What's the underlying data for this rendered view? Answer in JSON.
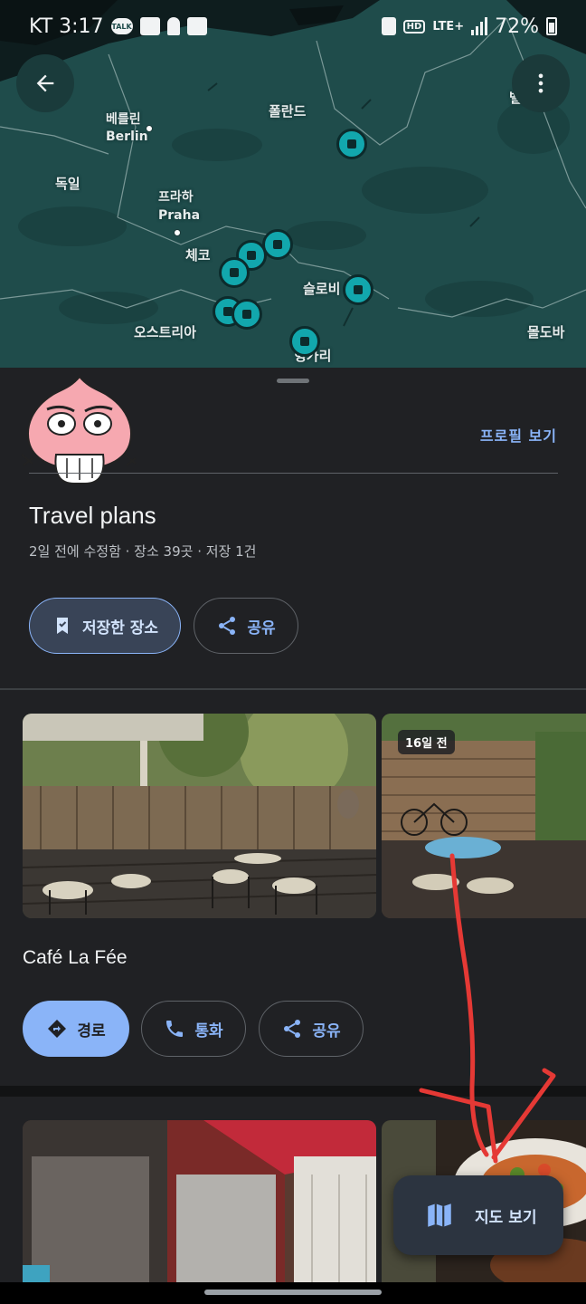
{
  "status_bar": {
    "carrier_time": "KT 3:17",
    "talk_badge": "TALK",
    "hd": "HD",
    "network": "LTE+",
    "battery": "72%"
  },
  "map": {
    "labels": {
      "berlin_ko": "베를린",
      "berlin_en": "Berlin",
      "germany": "독일",
      "poland": "폴란드",
      "prague_ko": "프라하",
      "prague_en": "Praha",
      "czech": "체코",
      "slovakia": "슬로비",
      "austria": "오스트리아",
      "hungary": "헝가리",
      "belarus": "벨라루스",
      "moldova": "몰도바"
    }
  },
  "profile": {
    "link": "프로필 보기"
  },
  "list": {
    "title": "Travel plans",
    "meta": "2일 전에 수정함 · 장소 39곳 · 저장 1건",
    "saved_button": "저장한 장소",
    "share_button": "공유"
  },
  "place1": {
    "photo_badge": "16일 전",
    "name": "Café La Fée",
    "directions": "경로",
    "call": "통화",
    "share": "공유"
  },
  "fab": {
    "label": "지도 보기"
  },
  "colors": {
    "accent": "#8ab4f8",
    "map_bg": "#1f4c4b",
    "pin": "#12a7ad",
    "annotation": "#e53935"
  }
}
